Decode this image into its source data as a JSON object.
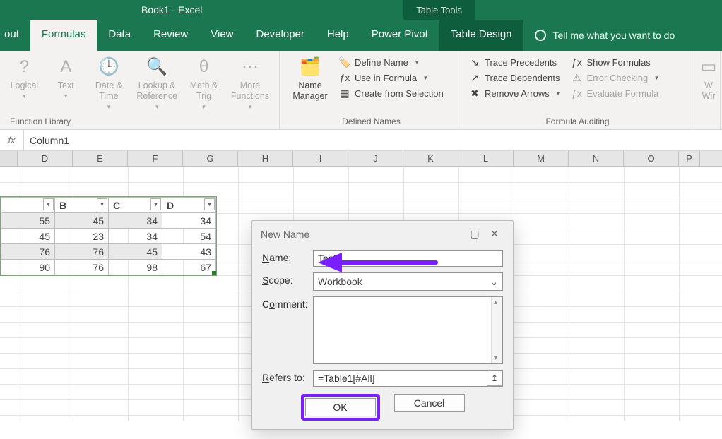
{
  "title": "Book1  -  Excel",
  "table_tools": "Table Tools",
  "tabs": {
    "0": "out",
    "1": "Formulas",
    "2": "Data",
    "3": "Review",
    "4": "View",
    "5": "Developer",
    "6": "Help",
    "7": "Power Pivot",
    "8": "Table Design"
  },
  "tellme": "Tell me what you want to do",
  "ribbon": {
    "functionlib": {
      "items": {
        "logical": "Logical",
        "text": "Text",
        "date": "Date & Time",
        "lookup": "Lookup & Reference",
        "math": "Math & Trig",
        "more": "More Functions"
      },
      "title": "Function Library"
    },
    "namemanager": "Name Manager",
    "define": "Define Name",
    "usein": "Use in Formula",
    "createsel": "Create from Selection",
    "definednames_title": "Defined Names",
    "tracep": "Trace Precedents",
    "traced": "Trace Dependents",
    "removea": "Remove Arrows",
    "showf": "Show Formulas",
    "errchk": "Error Checking",
    "evalf": "Evaluate Formula",
    "audit_title": "Formula Auditing",
    "watch": "W",
    "watch2": "Wir"
  },
  "fx_label": "fx",
  "fx_value": "Column1",
  "cols": {
    "D": "D",
    "E": "E",
    "F": "F",
    "G": "G",
    "H": "H",
    "I": "I",
    "J": "J",
    "K": "K",
    "L": "L",
    "M": "M",
    "N": "N",
    "O": "O",
    "P": "P"
  },
  "table": {
    "headers": {
      "b": "B",
      "c": "C",
      "d": "D"
    },
    "rows": [
      {
        "a": "55",
        "b": "45",
        "c": "34",
        "d": "34"
      },
      {
        "a": "45",
        "b": "23",
        "c": "34",
        "d": "54"
      },
      {
        "a": "76",
        "b": "76",
        "c": "45",
        "d": "43"
      },
      {
        "a": "90",
        "b": "76",
        "c": "98",
        "d": "67"
      }
    ]
  },
  "dialog": {
    "title": "New Name",
    "name_label": "Name:",
    "name_value": "Test",
    "scope_label": "Scope:",
    "scope_value": "Workbook",
    "comment_label": "Comment:",
    "refers_label": "Refers to:",
    "refers_value": "=Table1[#All]",
    "ok": "OK",
    "cancel": "Cancel"
  }
}
